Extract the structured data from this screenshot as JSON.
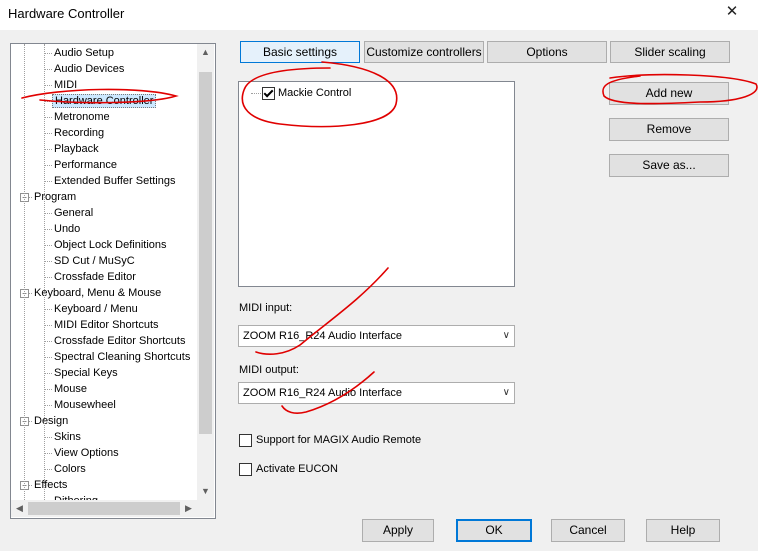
{
  "window": {
    "title": "Hardware Controller",
    "close_glyph": "✕"
  },
  "tree": {
    "items": [
      {
        "label": "Audio Setup",
        "level": 1
      },
      {
        "label": "Audio Devices",
        "level": 1
      },
      {
        "label": "MIDI",
        "level": 1
      },
      {
        "label": "Hardware Controller",
        "level": 1,
        "selected": true
      },
      {
        "label": "Metronome",
        "level": 1
      },
      {
        "label": "Recording",
        "level": 1
      },
      {
        "label": "Playback",
        "level": 1
      },
      {
        "label": "Performance",
        "level": 1
      },
      {
        "label": "Extended Buffer Settings",
        "level": 1
      },
      {
        "label": "Program",
        "level": 0
      },
      {
        "label": "General",
        "level": 1
      },
      {
        "label": "Undo",
        "level": 1
      },
      {
        "label": "Object Lock Definitions",
        "level": 1
      },
      {
        "label": "SD Cut / MuSyC",
        "level": 1
      },
      {
        "label": "Crossfade Editor",
        "level": 1
      },
      {
        "label": "Keyboard, Menu & Mouse",
        "level": 0
      },
      {
        "label": "Keyboard / Menu",
        "level": 1
      },
      {
        "label": "MIDI Editor Shortcuts",
        "level": 1
      },
      {
        "label": "Crossfade Editor Shortcuts",
        "level": 1
      },
      {
        "label": "Spectral Cleaning Shortcuts",
        "level": 1
      },
      {
        "label": "Special Keys",
        "level": 1
      },
      {
        "label": "Mouse",
        "level": 1
      },
      {
        "label": "Mousewheel",
        "level": 1
      },
      {
        "label": "Design",
        "level": 0
      },
      {
        "label": "Skins",
        "level": 1
      },
      {
        "label": "View Options",
        "level": 1
      },
      {
        "label": "Colors",
        "level": 1
      },
      {
        "label": "Effects",
        "level": 0
      },
      {
        "label": "Dithering",
        "level": 1
      }
    ]
  },
  "tabs": [
    {
      "label": "Basic settings",
      "active": true
    },
    {
      "label": "Customize controllers"
    },
    {
      "label": "Options"
    },
    {
      "label": "Slider scaling"
    }
  ],
  "controllers": [
    {
      "label": "Mackie Control",
      "checked": true
    }
  ],
  "side_buttons": {
    "add_new": "Add new",
    "remove": "Remove",
    "save_as": "Save as..."
  },
  "midi_input": {
    "label": "MIDI input:",
    "value": "ZOOM R16_R24 Audio Interface"
  },
  "midi_output": {
    "label": "MIDI output:",
    "value": "ZOOM R16_R24 Audio Interface"
  },
  "checkboxes": {
    "magix_remote": {
      "label": "Support for MAGIX Audio Remote",
      "checked": false
    },
    "eucon": {
      "label": "Activate EUCON",
      "checked": false
    }
  },
  "footer": {
    "apply": "Apply",
    "ok": "OK",
    "cancel": "Cancel",
    "help": "Help"
  },
  "icons": {
    "scroll_up": "▲",
    "scroll_down": "▼",
    "scroll_left": "◀",
    "scroll_right": "▶",
    "combo_arrow": "∨",
    "minus": "−"
  },
  "colors": {
    "annotation": "#e00000",
    "accent": "#0078d7"
  }
}
